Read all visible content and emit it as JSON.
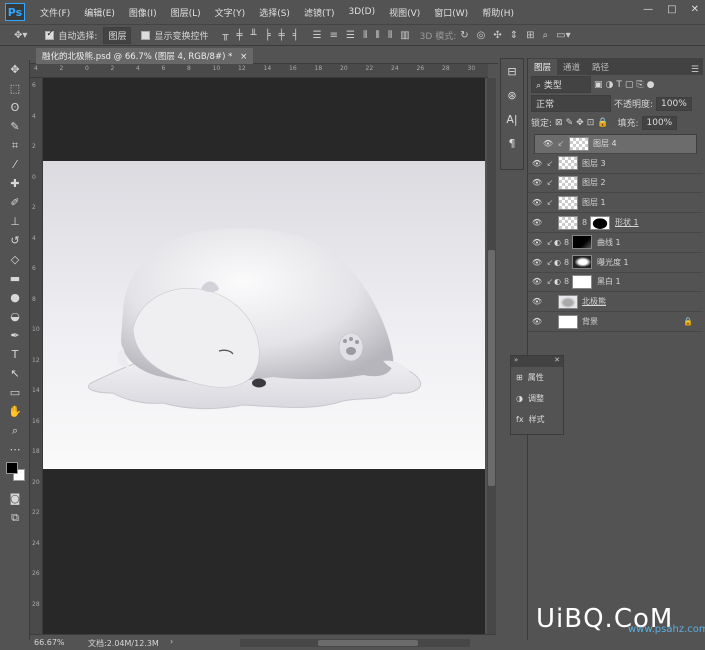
{
  "app": {
    "logo": "Ps"
  },
  "menubar": {
    "items": [
      "文件(F)",
      "编辑(E)",
      "图像(I)",
      "图层(L)",
      "文字(Y)",
      "选择(S)",
      "滤镜(T)",
      "3D(D)",
      "视图(V)",
      "窗口(W)",
      "帮助(H)"
    ],
    "controls": [
      "—",
      "□",
      "✕"
    ]
  },
  "options": {
    "auto_select_label": "自动选择:",
    "auto_select_value": "图层",
    "show_transform_label": "显示变换控件",
    "mode3d_label": "3D 模式:"
  },
  "document": {
    "tab_title": "融化的北极熊.psd @ 66.7% (图层 4, RGB/8#) *",
    "close": "×"
  },
  "rulers": {
    "top": [
      "4",
      "2",
      "0",
      "2",
      "4",
      "6",
      "8",
      "10",
      "12",
      "14",
      "16",
      "18",
      "20",
      "22",
      "24",
      "26",
      "28",
      "30"
    ],
    "left": [
      "6",
      "4",
      "2",
      "0",
      "2",
      "4",
      "6",
      "8",
      "10",
      "12",
      "14",
      "16",
      "18",
      "20",
      "22",
      "24",
      "26",
      "28"
    ]
  },
  "status": {
    "zoom": "66.67%",
    "doc_info": "文档:2.04M/12.3M"
  },
  "toolbar": {
    "icons": [
      "move-icon",
      "marquee-icon",
      "lasso-icon",
      "quick-select-icon",
      "crop-icon",
      "eyedropper-icon",
      "healing-icon",
      "brush-icon",
      "stamp-icon",
      "history-brush-icon",
      "eraser-icon",
      "gradient-icon",
      "blur-icon",
      "dodge-icon",
      "pen-icon",
      "type-icon",
      "path-select-icon",
      "shape-icon",
      "hand-icon",
      "zoom-icon",
      "more-icon"
    ],
    "glyphs": [
      "✥",
      "⬚",
      "ʘ",
      "✎",
      "⌗",
      "⁄",
      "✚",
      "✐",
      "⊥",
      "↺",
      "◇",
      "▬",
      "●",
      "◒",
      "✒",
      "T",
      "↖",
      "▭",
      "✋",
      "⌕",
      "⋯"
    ]
  },
  "panel": {
    "tabs": [
      "图层",
      "通道",
      "路径"
    ],
    "filter_label": "类型",
    "blend_mode": "正常",
    "opacity_label": "不透明度:",
    "opacity_value": "100%",
    "lock_label": "锁定:",
    "fill_label": "填充:",
    "fill_value": "100%"
  },
  "layers": [
    {
      "name": "图层 4",
      "thumb": "checker",
      "clipped": true,
      "selected": true
    },
    {
      "name": "图层 3",
      "thumb": "checker",
      "clipped": true
    },
    {
      "name": "图层 2",
      "thumb": "checker",
      "clipped": true
    },
    {
      "name": "图层 1",
      "thumb": "checker",
      "clipped": true
    },
    {
      "name": "形状 1",
      "thumb": "shape"
    },
    {
      "name": "曲线 1",
      "thumb": "curves",
      "clipped": true
    },
    {
      "name": "曝光度 1",
      "thumb": "exposure",
      "clipped": true
    },
    {
      "name": "黑白 1",
      "thumb": "bw",
      "clipped": true
    },
    {
      "name": "北极熊",
      "thumb": "bear"
    },
    {
      "name": "背景",
      "thumb": "white",
      "locked": true
    }
  ],
  "mini_panel": {
    "header_left": "»",
    "header_right": "✕",
    "items": [
      {
        "label": "属性",
        "icon": "properties-icon"
      },
      {
        "label": "调整",
        "icon": "adjustments-icon"
      },
      {
        "label": "样式",
        "icon": "styles-icon"
      }
    ]
  },
  "watermark": {
    "text": "UiBQ.CoM",
    "sub": "www.psahz.com"
  }
}
